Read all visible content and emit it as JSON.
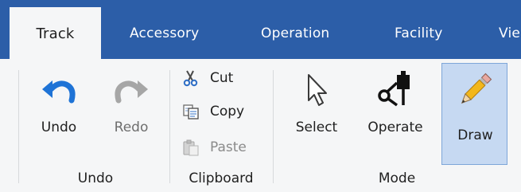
{
  "tabs": [
    "Track",
    "Accessory",
    "Operation",
    "Facility",
    "Vie"
  ],
  "groups": {
    "undo": {
      "label": "Undo",
      "undo_label": "Undo",
      "redo_label": "Redo"
    },
    "clipboard": {
      "label": "Clipboard",
      "cut_label": "Cut",
      "copy_label": "Copy",
      "paste_label": "Paste"
    },
    "mode": {
      "label": "Mode",
      "select_label": "Select",
      "operate_label": "Operate",
      "draw_label": "Draw"
    }
  },
  "state": {
    "active_tab": "Track",
    "selected_mode": "Draw",
    "disabled": [
      "Redo",
      "Paste"
    ]
  },
  "icons": [
    "undo-icon",
    "redo-icon",
    "scissors-icon",
    "copy-icon",
    "paste-icon",
    "cursor-icon",
    "operate-icon",
    "pencil-icon"
  ],
  "colors": {
    "tab_bar": "#2c5ea8",
    "ribbon_bg": "#f5f6f7",
    "selected_bg": "#c6d9f2",
    "selected_border": "#7ea6d9",
    "undo_blue": "#1e73d6"
  }
}
